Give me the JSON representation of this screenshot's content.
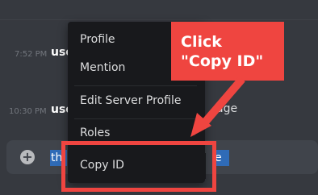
{
  "chat": {
    "rows": [
      {
        "time": "7:52 PM",
        "name_fragment": "use"
      },
      {
        "time": "10:30 PM",
        "name_fragment": "use",
        "message_fragment": "age"
      }
    ],
    "composer": {
      "add_icon": "plus-circle-icon",
      "selected_left": "th",
      "selected_right": "e"
    }
  },
  "context_menu": {
    "items": [
      {
        "label": "Profile"
      },
      {
        "label": "Mention"
      },
      {
        "label": "Edit Server Profile"
      },
      {
        "label": "Roles",
        "submenu_icon": "chevron-right-icon"
      },
      {
        "label": "Copy ID"
      }
    ]
  },
  "annotation": {
    "line1": "Click",
    "line2": "\"Copy ID\"",
    "color": "#ef4540",
    "arrow_icon": "arrow-icon"
  },
  "colors": {
    "background": "#36393f",
    "menu": "#18191c",
    "selection": "#2f6bb7",
    "annotation": "#ef4540"
  }
}
